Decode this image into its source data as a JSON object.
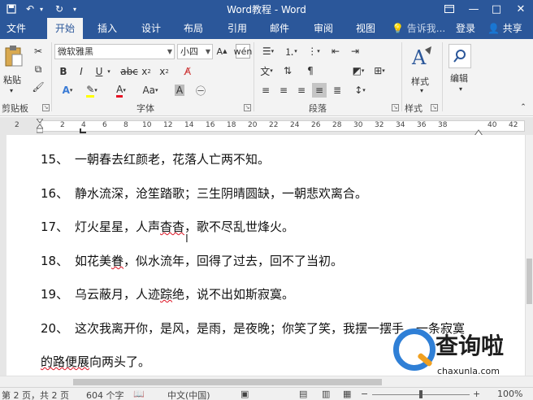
{
  "window": {
    "title": "Word教程 - Word",
    "restore_icon": "ribbon-display-icon",
    "minimize": "—",
    "maximize": "□",
    "close": "✕"
  },
  "quick_access": {
    "save_icon": "save-icon",
    "undo_icon": "undo-icon",
    "redo_icon": "redo-icon",
    "more_icon": "customize-icon"
  },
  "tabs": [
    {
      "label": "文件",
      "active": false
    },
    {
      "label": "开始",
      "active": true
    },
    {
      "label": "插入",
      "active": false
    },
    {
      "label": "设计",
      "active": false
    },
    {
      "label": "布局",
      "active": false
    },
    {
      "label": "引用",
      "active": false
    },
    {
      "label": "邮件",
      "active": false
    },
    {
      "label": "审阅",
      "active": false
    },
    {
      "label": "视图",
      "active": false
    }
  ],
  "tell_me": "告诉我...",
  "sign_in": "登录",
  "share": "共享",
  "ribbon": {
    "clipboard": {
      "paste": "粘贴",
      "group": "剪贴板"
    },
    "font": {
      "name": "微软雅黑",
      "size": "小四",
      "group": "字体"
    },
    "paragraph": {
      "group": "段落"
    },
    "styles": {
      "label": "样式",
      "group": "样式"
    },
    "editing": {
      "label": "编辑"
    }
  },
  "ruler": {
    "numbers": [
      "2",
      "2",
      "4",
      "6",
      "8",
      "10",
      "12",
      "14",
      "16",
      "18",
      "20",
      "22",
      "24",
      "26",
      "28",
      "30",
      "32",
      "34",
      "36",
      "38",
      "40",
      "42"
    ]
  },
  "document": {
    "lines": [
      {
        "num": "15、",
        "text": "一朝春去红颜老，花落人亡两不知。"
      },
      {
        "num": "16、",
        "text": "静水流深，沧笙踏歌；三生阴晴圆缺，一朝悲欢离合。"
      },
      {
        "num": "17、",
        "pre": "灯火星星，人声",
        "squiggle": "杳杳",
        "post": "，歌不尽乱世烽火。"
      },
      {
        "num": "18、",
        "pre": "如花美",
        "squiggle": "眷",
        "post": "，似水流年，回得了过去，回不了当初。"
      },
      {
        "num": "19、",
        "pre": "乌云蔽月，人迹",
        "squiggle": "踪",
        "post": "绝，说不出如斯寂寞。"
      },
      {
        "num": "20、",
        "text": "这次我离开你，是风，是雨，是夜晚；你笑了笑，我摆一摆手，一条寂寞"
      },
      {
        "num": "",
        "pre": "",
        "squiggle": "的路便展",
        "post": "向两头了。"
      }
    ]
  },
  "status_bar": {
    "page": "第 2 页，共 2 页",
    "words": "604 个字",
    "language": "中文(中国)",
    "zoom": "100%"
  },
  "watermark": {
    "brand": "查询啦",
    "url": "chaxunla.com"
  },
  "colors": {
    "accent": "#2b579a",
    "ribbon_bg": "#f3f3f3",
    "highlight_yellow": "#ffff00",
    "font_red": "#e81123"
  }
}
